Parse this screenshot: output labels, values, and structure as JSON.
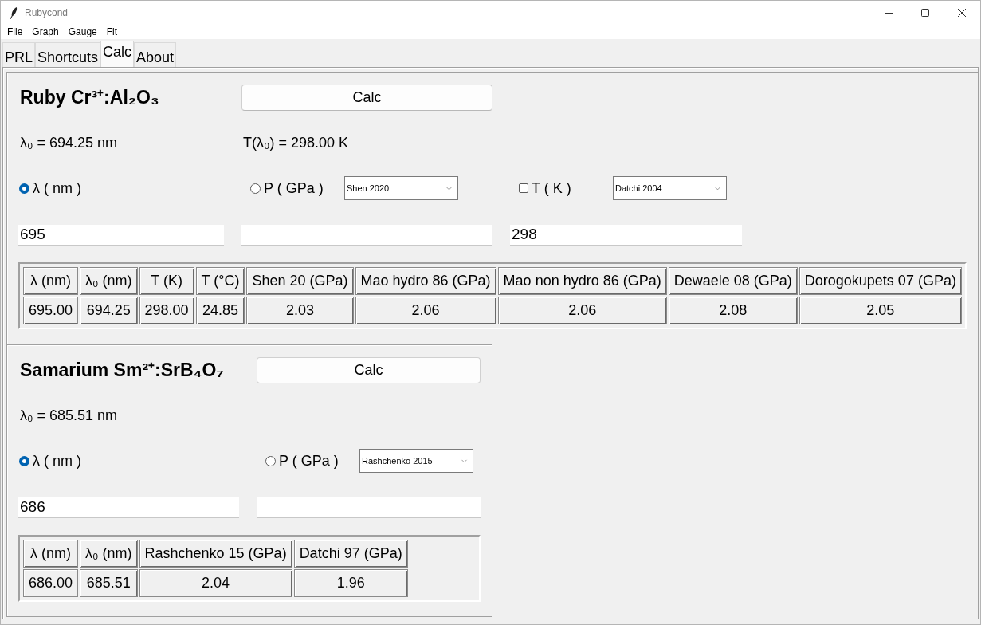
{
  "window": {
    "title": "Rubycond"
  },
  "menu": [
    "File",
    "Graph",
    "Gauge",
    "Fit"
  ],
  "tabs": [
    {
      "label": "PRL",
      "selected": false
    },
    {
      "label": "Shortcuts",
      "selected": false
    },
    {
      "label": "Calc",
      "selected": true
    },
    {
      "label": "About",
      "selected": false
    }
  ],
  "sections": [
    {
      "title": "Ruby Cr³⁺:Al₂O₃",
      "calc_button": "Calc",
      "readouts": [
        "λ₀ = 694.25 nm",
        "T(λ₀) = 298.00 K"
      ],
      "options": [
        {
          "kind": "radio",
          "label": "λ ( nm )",
          "selected": true,
          "value": "695"
        },
        {
          "kind": "radio",
          "label": "P ( GPa )",
          "selected": false,
          "dropdown": "Shen 2020"
        },
        {
          "kind": "checkbox",
          "label": "T ( K )",
          "checked": false,
          "dropdown": "Datchi 2004",
          "value": "298"
        }
      ],
      "table": {
        "columns": [
          "λ (nm)",
          "λ₀ (nm)",
          "T (K)",
          "T (°C)",
          "Shen 20 (GPa)",
          "Mao hydro 86 (GPa)",
          "Mao non hydro 86 (GPa)",
          "Dewaele 08 (GPa)",
          "Dorogokupets 07 (GPa)"
        ],
        "rows": [
          [
            "695.00",
            "694.25",
            "298.00",
            "24.85",
            "2.03",
            "2.06",
            "2.06",
            "2.08",
            "2.05"
          ]
        ]
      }
    },
    {
      "title": "Samarium Sm²⁺:SrB₄O₇",
      "calc_button": "Calc",
      "readouts": [
        "λ₀ = 685.51 nm"
      ],
      "options": [
        {
          "kind": "radio",
          "label": "λ ( nm )",
          "selected": true,
          "value": "686"
        },
        {
          "kind": "radio",
          "label": "P ( GPa )",
          "selected": false,
          "dropdown": "Rashchenko 2015"
        }
      ],
      "table": {
        "columns": [
          "λ (nm)",
          "λ₀ (nm)",
          "Rashchenko 15 (GPa)",
          "Datchi 97 (GPa)"
        ],
        "rows": [
          [
            "686.00",
            "685.51",
            "2.04",
            "1.96"
          ]
        ]
      }
    }
  ]
}
